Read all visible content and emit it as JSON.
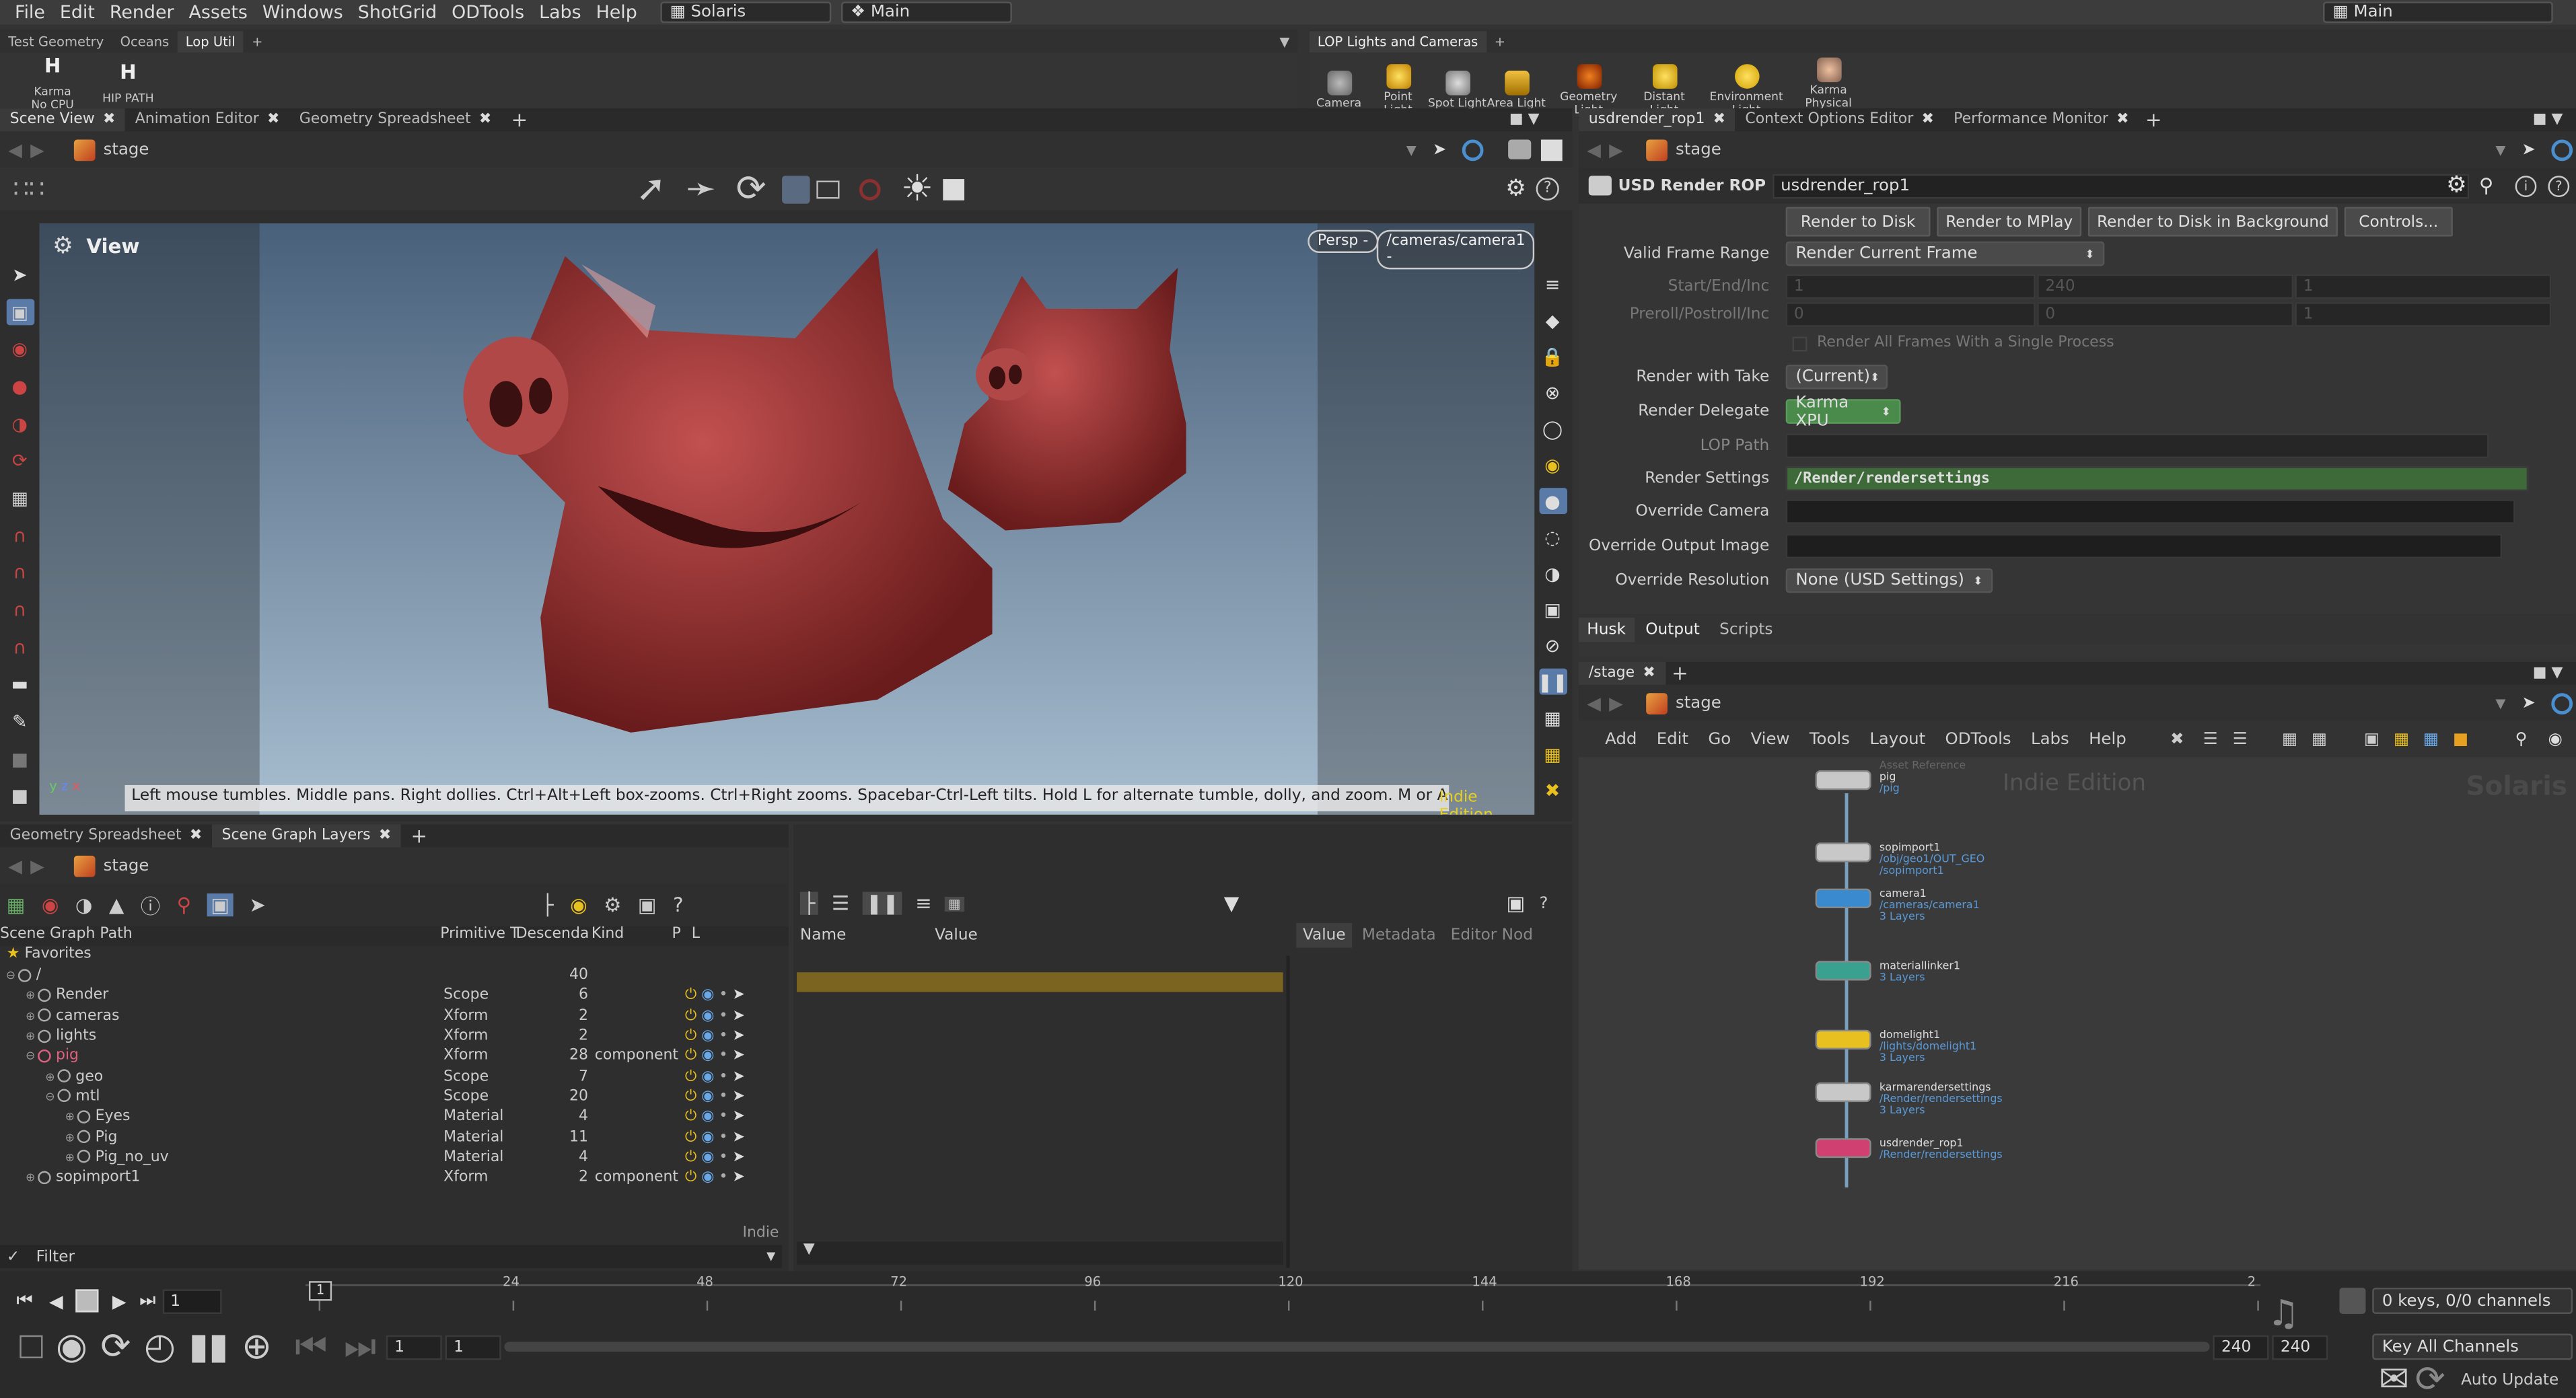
{
  "menubar": {
    "items": [
      "File",
      "Edit",
      "Render",
      "Assets",
      "Windows",
      "ShotGrid",
      "ODTools",
      "Labs",
      "Help"
    ],
    "desktop": "Solaris",
    "context": "Main",
    "right_desktop": "Main"
  },
  "shelf_left": {
    "tabs": [
      "Test Geometry",
      "Oceans",
      "Lop Util"
    ],
    "active": 2,
    "tools": [
      {
        "label": "Karma\nNo CPU",
        "icon": "karma-h-icon"
      },
      {
        "label": "HIP PATH",
        "icon": "hip-h-icon"
      }
    ]
  },
  "shelf_right": {
    "tabs": [
      "LOP Lights and Cameras"
    ],
    "tools": [
      "Camera",
      "Point Light",
      "Spot Light",
      "Area Light",
      "Geometry Light",
      "Distant Light",
      "Environment Light",
      "Karma Physical Sk..."
    ]
  },
  "scene_view": {
    "tabs": [
      "Scene View",
      "Animation Editor",
      "Geometry Spreadsheet"
    ],
    "path": "stage",
    "view_label": "View",
    "persp": "Persp -",
    "camera": "/cameras/camera1 -",
    "hint": "Left mouse tumbles. Middle pans. Right dollies. Ctrl+Alt+Left box-zooms. Ctrl+Right zooms. Spacebar-Ctrl-Left tilts. Hold L for alternate tumble, dolly, and zoom. M or Alt+M for First Person Navigation.",
    "edition": "Indie Edition",
    "axes": {
      "y": "y",
      "z": "z",
      "x": "x"
    }
  },
  "params": {
    "tabs": [
      "usdrender_rop1",
      "Context Options Editor",
      "Performance Monitor"
    ],
    "path": "stage",
    "node_type": "USD Render ROP",
    "node_name": "usdrender_rop1",
    "buttons": [
      "Render to Disk",
      "Render to MPlay",
      "Render to Disk in Background",
      "Controls..."
    ],
    "valid_frame_range_label": "Valid Frame Range",
    "valid_frame_range": "Render Current Frame",
    "start_label": "Start/End/Inc",
    "start_values": [
      "1",
      "240",
      "1"
    ],
    "preroll_label": "Preroll/Postroll/Inc",
    "preroll_values": [
      "0",
      "0",
      "1"
    ],
    "single_process": "Render All Frames With a Single Process",
    "take_label": "Render with Take",
    "take": "(Current)",
    "delegate_label": "Render Delegate",
    "delegate": "Karma XPU",
    "lop_path_label": "LOP Path",
    "lop_path": "",
    "settings_label": "Render Settings",
    "settings": "/Render/rendersettings",
    "override_cam_label": "Override Camera",
    "override_img_label": "Override Output Image",
    "override_res_label": "Override Resolution",
    "override_res": "None (USD Settings)",
    "sub_tabs": [
      "Husk",
      "Output",
      "Scripts"
    ]
  },
  "network": {
    "tabs": [
      "/stage"
    ],
    "path": "stage",
    "menu": [
      "Add",
      "Edit",
      "Go",
      "View",
      "Tools",
      "Layout",
      "ODTools",
      "Labs",
      "Help"
    ],
    "watermark": "Indie Edition",
    "context_label": "Solaris",
    "nodes": [
      {
        "name": "pig",
        "sub": [
          "/pig"
        ],
        "top_note": "Asset Reference",
        "color": "#c8c8c8"
      },
      {
        "name": "sopimport1",
        "sub": [
          "/obj/geo1/OUT_GEO",
          "/sopimport1"
        ],
        "color": "#c8c8c8"
      },
      {
        "name": "camera1",
        "sub": [
          "/cameras/camera1",
          "3 Layers"
        ],
        "color": "#3a8ad0"
      },
      {
        "name": "materiallinker1",
        "sub": [
          "3 Layers"
        ],
        "color": "#3aa090"
      },
      {
        "name": "domelight1",
        "sub": [
          "/lights/domelight1",
          "3 Layers"
        ],
        "color": "#e8c020"
      },
      {
        "name": "karmarendersettings",
        "sub": [
          "/Render/rendersettings",
          "3 Layers"
        ],
        "color": "#c8c8c8"
      },
      {
        "name": "usdrender_rop1",
        "sub": [
          "/Render/rendersettings"
        ],
        "color": "#d04070"
      }
    ]
  },
  "scene_graph": {
    "tabs": [
      "Geometry Spreadsheet",
      "Scene Graph Layers"
    ],
    "path": "stage",
    "columns": [
      "Scene Graph Path",
      "Primitive T",
      "Descenda",
      "Kind",
      "P",
      "L"
    ],
    "favorites": "Favorites",
    "rows": [
      {
        "name": "/",
        "type": "",
        "desc": "40",
        "kind": "",
        "indent": 0,
        "icons": false
      },
      {
        "name": "Render",
        "type": "Scope",
        "desc": "6",
        "kind": "",
        "indent": 1,
        "icons": true
      },
      {
        "name": "cameras",
        "type": "Xform",
        "desc": "2",
        "kind": "",
        "indent": 1,
        "icons": true
      },
      {
        "name": "lights",
        "type": "Xform",
        "desc": "2",
        "kind": "",
        "indent": 1,
        "icons": true
      },
      {
        "name": "pig",
        "type": "Xform",
        "desc": "28",
        "kind": "component",
        "indent": 1,
        "icons": true,
        "highlight": true
      },
      {
        "name": "geo",
        "type": "Scope",
        "desc": "7",
        "kind": "",
        "indent": 2,
        "icons": true
      },
      {
        "name": "mtl",
        "type": "Scope",
        "desc": "20",
        "kind": "",
        "indent": 2,
        "icons": true
      },
      {
        "name": "Eyes",
        "type": "Material",
        "desc": "4",
        "kind": "",
        "indent": 3,
        "icons": true
      },
      {
        "name": "Pig",
        "type": "Material",
        "desc": "11",
        "kind": "",
        "indent": 3,
        "icons": true
      },
      {
        "name": "Pig_no_uv",
        "type": "Material",
        "desc": "4",
        "kind": "",
        "indent": 3,
        "icons": true
      },
      {
        "name": "sopimport1",
        "type": "Xform",
        "desc": "2",
        "kind": "component",
        "indent": 1,
        "icons": true
      }
    ],
    "filter_label": "Filter",
    "indie": "Indie"
  },
  "properties": {
    "columns": [
      "Name",
      "Value"
    ],
    "side_tabs": [
      "Value",
      "Metadata",
      "Editor Nod"
    ]
  },
  "timeline": {
    "frame": "1",
    "ticks": [
      "1",
      "24",
      "48",
      "72",
      "96",
      "120",
      "144",
      "168",
      "192",
      "216",
      "2"
    ],
    "start": "1",
    "start2": "1",
    "end": "240",
    "end2": "240",
    "keys": "0 keys, 0/0 channels",
    "key_all": "Key All Channels",
    "auto_update": "Auto Update"
  }
}
